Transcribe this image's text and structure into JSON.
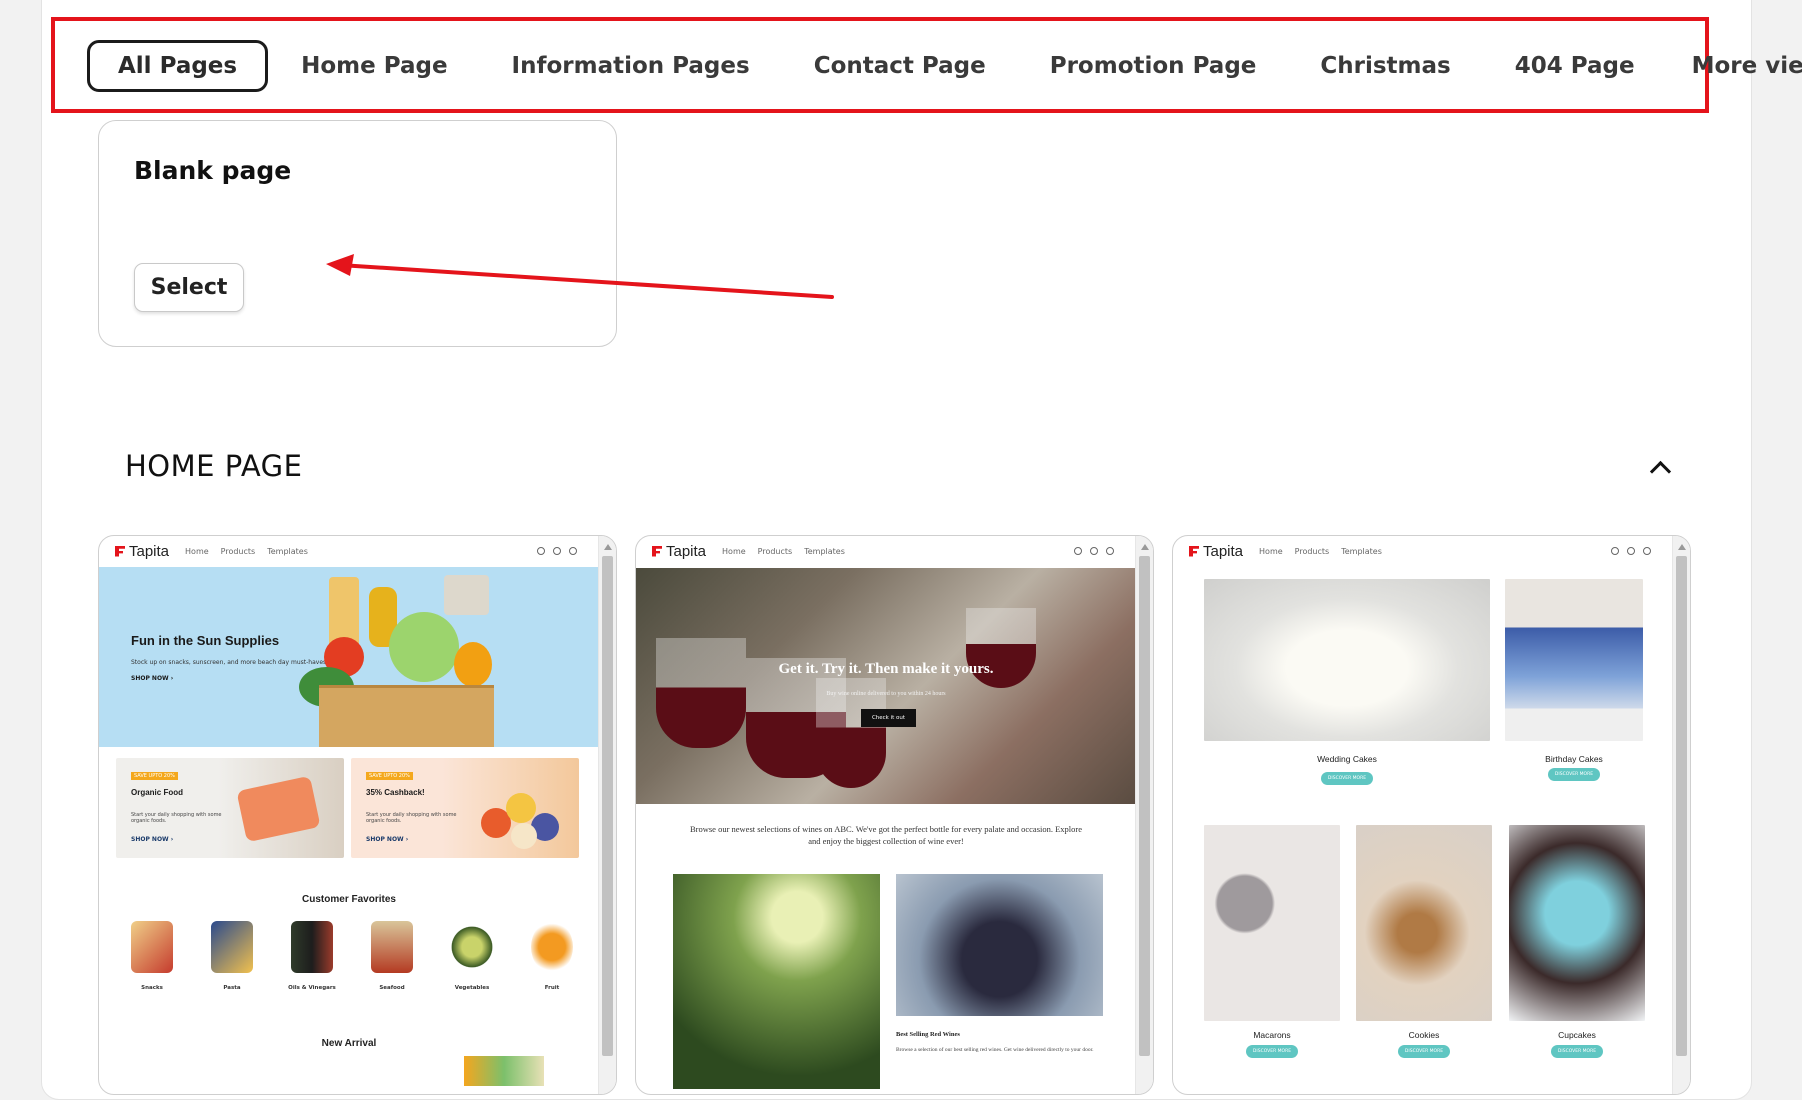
{
  "tabs": [
    {
      "label": "All Pages",
      "active": true
    },
    {
      "label": "Home Page"
    },
    {
      "label": "Information Pages"
    },
    {
      "label": "Contact Page"
    },
    {
      "label": "Promotion Page"
    },
    {
      "label": "Christmas"
    },
    {
      "label": "404 Page"
    },
    {
      "label": "More views",
      "icon": "chevron-down-icon"
    }
  ],
  "blank_card": {
    "title": "Blank page",
    "select_label": "Select"
  },
  "section": {
    "title": "HOME PAGE",
    "toggle_icon": "chevron-up-icon"
  },
  "highlight_color": "#e4141b",
  "previews": {
    "brand": "Tapita",
    "nav_links": [
      "Home",
      "Products",
      "Templates"
    ],
    "grocery": {
      "hero_title": "Fun in the Sun Supplies",
      "hero_sub": "Stock up on snacks, sunscreen, and more beach day must-haves.",
      "hero_shop": "SHOP NOW ›",
      "promo1": {
        "badge": "SAVE UPTO 20%",
        "title": "Organic Food",
        "text": "Start your daily shopping with some organic foods.",
        "shop": "SHOP NOW ›"
      },
      "promo2": {
        "badge": "SAVE UPTO 20%",
        "title": "35% Cashback!",
        "text": "Start your daily shopping with some organic foods.",
        "shop": "SHOP NOW ›"
      },
      "favorites_title": "Customer Favorites",
      "categories": [
        "Snacks",
        "Pasta",
        "Oils & Vinegars",
        "Seafood",
        "Vegetables",
        "Fruit"
      ],
      "new_arrival_title": "New Arrival"
    },
    "wine": {
      "hero_title": "Get it. Try it. Then make it yours.",
      "hero_sub": "Buy wine online delivered to you within 24 hours",
      "hero_button": "Check it out",
      "paragraph": "Browse our newest selections of wines on ABC. We've got the perfect bottle for every palate and occasion. Explore and enjoy the biggest collection of wine ever!",
      "card_title": "Best Selling Red Wines",
      "card_text": "Browse a selection of our best selling red wines. Get wine delivered directly to your door."
    },
    "cakes": {
      "items": [
        "Wedding Cakes",
        "Birthday Cakes",
        "Macarons",
        "Cookies",
        "Cupcakes"
      ],
      "button": "DISCOVER MORE"
    }
  }
}
